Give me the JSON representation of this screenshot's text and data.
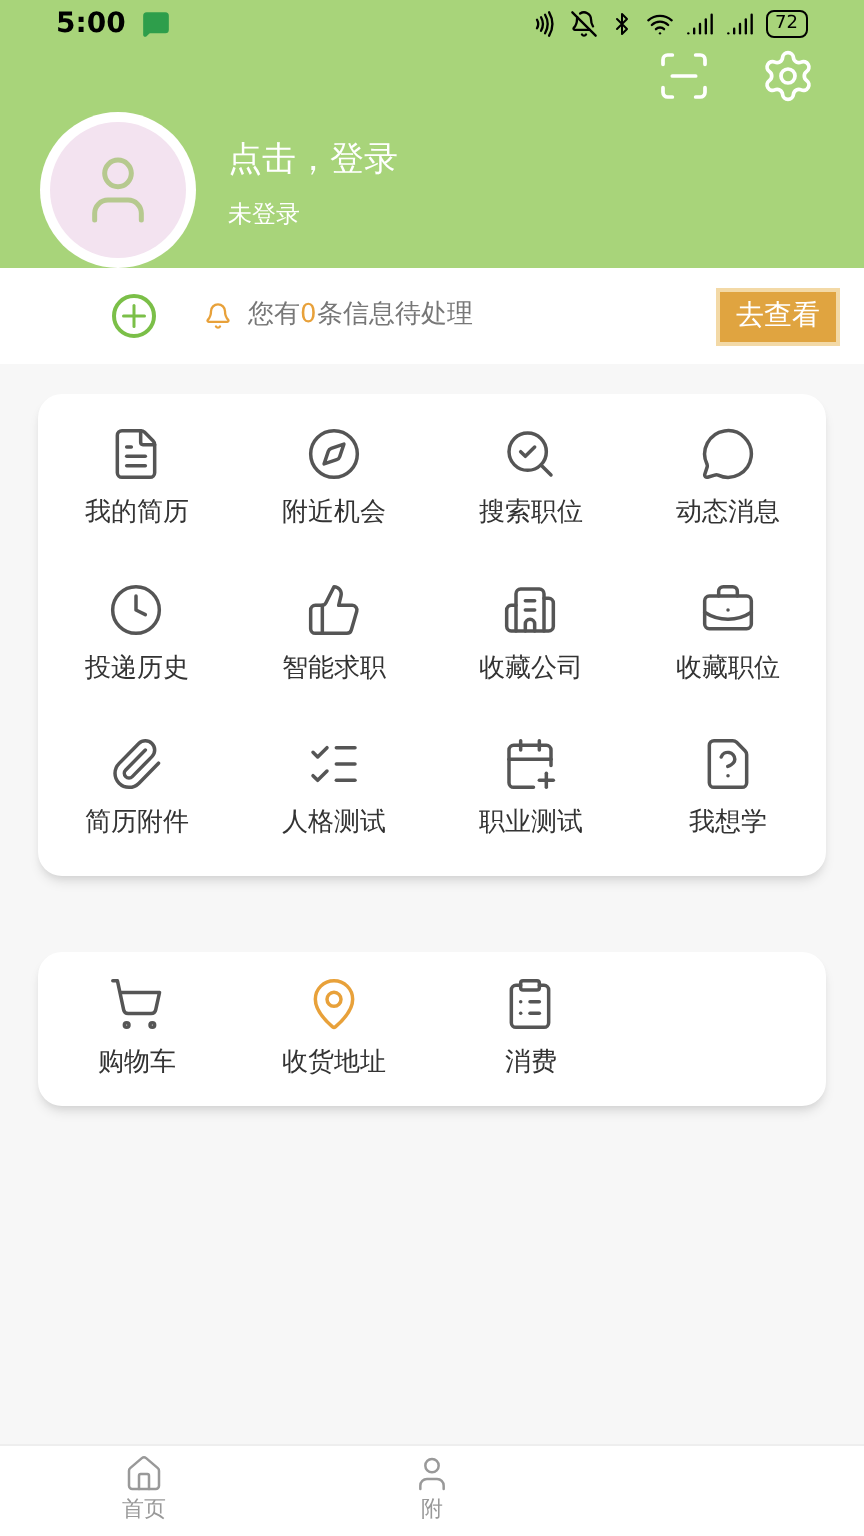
{
  "status_bar": {
    "time": "5:00",
    "battery": "72"
  },
  "profile": {
    "title": "点击，登录",
    "subtitle": "未登录"
  },
  "notice": {
    "before": "您有",
    "count": "0",
    "after": "条信息待处理",
    "button": "去查看"
  },
  "grid_menu": [
    {
      "label": "我的简历"
    },
    {
      "label": "附近机会"
    },
    {
      "label": "搜索职位"
    },
    {
      "label": "动态消息"
    },
    {
      "label": "投递历史"
    },
    {
      "label": "智能求职"
    },
    {
      "label": "收藏公司"
    },
    {
      "label": "收藏职位"
    },
    {
      "label": "简历附件"
    },
    {
      "label": "人格测试"
    },
    {
      "label": "职业测试"
    },
    {
      "label": "我想学"
    }
  ],
  "shop_menu": [
    {
      "label": "购物车"
    },
    {
      "label": "收货地址"
    },
    {
      "label": "消费"
    }
  ],
  "bottom_nav": [
    {
      "label": "首页"
    },
    {
      "label": "附"
    }
  ]
}
